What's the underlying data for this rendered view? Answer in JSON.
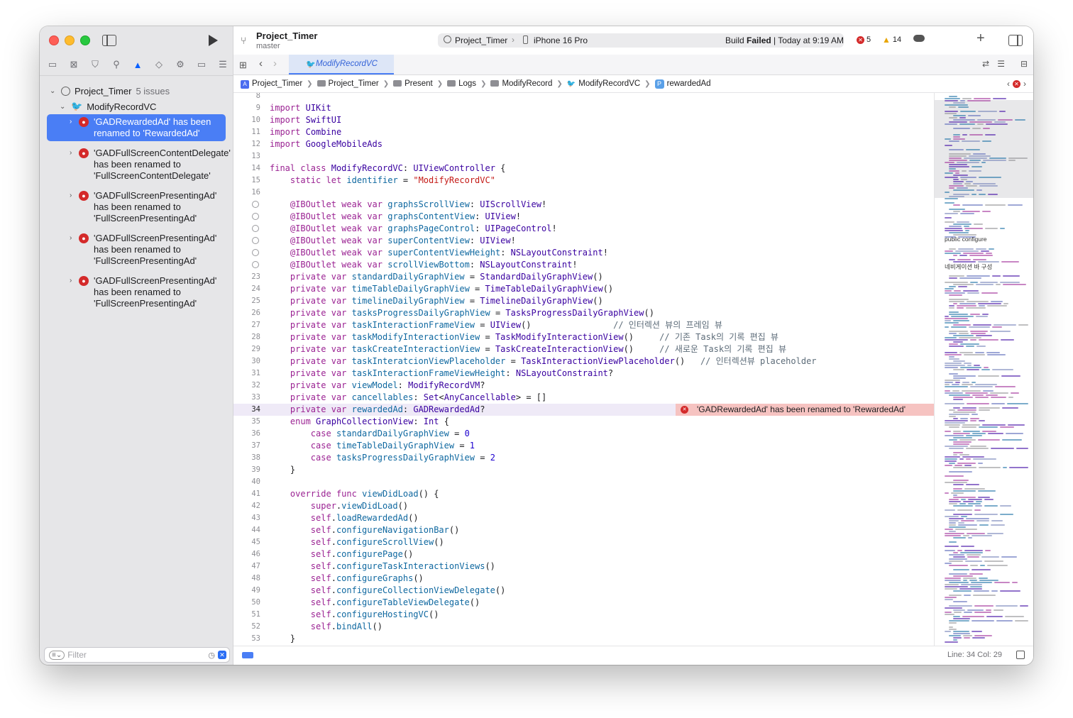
{
  "toolbar": {
    "project_title": "Project_Timer",
    "branch": "master",
    "scheme": "Project_Timer",
    "device": "iPhone 16 Pro",
    "build_status_prefix": "Build ",
    "build_status_bold": "Failed",
    "build_status_suffix": " | Today at 9:19 AM",
    "error_count": "5",
    "warning_count": "14"
  },
  "sidebar": {
    "project": "Project_Timer",
    "issue_count": "5 issues",
    "file": "ModifyRecordVC",
    "issues": [
      "'GADRewardedAd' has been renamed to 'RewardedAd'",
      "'GADFullScreenContentDelegate' has been renamed to 'FullScreenContentDelegate'",
      "'GADFullScreenPresentingAd' has been renamed to 'FullScreenPresentingAd'",
      "'GADFullScreenPresentingAd' has been renamed to 'FullScreenPresentingAd'",
      "'GADFullScreenPresentingAd' has been renamed to 'FullScreenPresentingAd'"
    ],
    "filter_placeholder": "Filter"
  },
  "tab": {
    "label": "ModifyRecordVC"
  },
  "breadcrumbs": [
    "Project_Timer",
    "Project_Timer",
    "Present",
    "Logs",
    "ModifyRecord",
    "ModifyRecordVC",
    "rewardedAd"
  ],
  "editor": {
    "inline_error": "'GADRewardedAd' has been renamed to 'RewardedAd'",
    "current_line": 34,
    "lines": [
      {
        "n": "8",
        "t": ""
      },
      {
        "n": "9",
        "t": "import UIKit"
      },
      {
        "n": "10",
        "t": "import SwiftUI"
      },
      {
        "n": "11",
        "t": "import Combine"
      },
      {
        "n": "12",
        "t": "import GoogleMobileAds"
      },
      {
        "n": "13",
        "t": ""
      },
      {
        "n": "14",
        "t": "final class ModifyRecordVC: UIViewController {"
      },
      {
        "n": "15",
        "t": "    static let identifier = \"ModifyRecordVC\""
      },
      {
        "n": "16",
        "t": ""
      },
      {
        "n": "",
        "t": "    @IBOutlet weak var graphsScrollView: UIScrollView!",
        "bp": true
      },
      {
        "n": "",
        "t": "    @IBOutlet weak var graphsContentView: UIView!",
        "bp": true
      },
      {
        "n": "",
        "t": "    @IBOutlet weak var graphsPageControl: UIPageControl!",
        "bp": true
      },
      {
        "n": "",
        "t": "    @IBOutlet weak var superContentView: UIView!",
        "bp": true
      },
      {
        "n": "",
        "t": "    @IBOutlet weak var superContentViewHeight: NSLayoutConstraint!",
        "bp": true
      },
      {
        "n": "",
        "t": "    @IBOutlet weak var scrollViewBottom: NSLayoutConstraint!",
        "bp": true
      },
      {
        "n": "23",
        "t": "    private var standardDailyGraphView = StandardDailyGraphView()"
      },
      {
        "n": "24",
        "t": "    private var timeTableDailyGraphView = TimeTableDailyGraphView()"
      },
      {
        "n": "25",
        "t": "    private var timelineDailyGraphView = TimelineDailyGraphView()"
      },
      {
        "n": "26",
        "t": "    private var tasksProgressDailyGraphView = TasksProgressDailyGraphView()"
      },
      {
        "n": "27",
        "t": "    private var taskInteractionFrameView = UIView()                // 인터렉션 뷰의 프레임 뷰"
      },
      {
        "n": "28",
        "t": "    private var taskModifyInteractionView = TaskModifyInteractionView()     // 기존 Task의 기록 편집 뷰"
      },
      {
        "n": "29",
        "t": "    private var taskCreateInteractionView = TaskCreateInteractionView()     // 새로운 Task의 기록 편집 뷰"
      },
      {
        "n": "30",
        "t": "    private var taskInteratcionViewPlaceholder = TaskInteractionViewPlaceholder()   // 인터렉션뷰 placeholder"
      },
      {
        "n": "31",
        "t": "    private var taskInteractionFrameViewHeight: NSLayoutConstraint?"
      },
      {
        "n": "32",
        "t": "    private var viewModel: ModifyRecordVM?"
      },
      {
        "n": "33",
        "t": "    private var cancellables: Set<AnyCancellable> = []"
      },
      {
        "n": "34",
        "t": "    private var rewardedAd: GADRewardedAd?"
      },
      {
        "n": "35",
        "t": "    enum GraphCollectionView: Int {"
      },
      {
        "n": "36",
        "t": "        case standardDailyGraphView = 0"
      },
      {
        "n": "37",
        "t": "        case timeTableDailyGraphView = 1"
      },
      {
        "n": "38",
        "t": "        case tasksProgressDailyGraphView = 2"
      },
      {
        "n": "39",
        "t": "    }"
      },
      {
        "n": "40",
        "t": ""
      },
      {
        "n": "41",
        "t": "    override func viewDidLoad() {"
      },
      {
        "n": "42",
        "t": "        super.viewDidLoad()"
      },
      {
        "n": "43",
        "t": "        self.loadRewardedAd()"
      },
      {
        "n": "44",
        "t": "        self.configureNavigationBar()"
      },
      {
        "n": "45",
        "t": "        self.configureScrollView()"
      },
      {
        "n": "46",
        "t": "        self.configurePage()"
      },
      {
        "n": "47",
        "t": "        self.configureTaskInteractionViews()"
      },
      {
        "n": "48",
        "t": "        self.configureGraphs()"
      },
      {
        "n": "49",
        "t": "        self.configureCollectionViewDelegate()"
      },
      {
        "n": "50",
        "t": "        self.configureTableViewDelegate()"
      },
      {
        "n": "51",
        "t": "        self.configureHostingVC()"
      },
      {
        "n": "52",
        "t": "        self.bindAll()"
      },
      {
        "n": "53",
        "t": "    }"
      }
    ]
  },
  "minimap": {
    "labels": [
      "public configure",
      "네비게이션 바 구성",
      "뷰 구성",
      "기기별 height...우와 아닌 경우)",
      "바인딩"
    ]
  },
  "status": {
    "position": "Line: 34  Col: 29"
  },
  "colors": {
    "accent": "#4a7ef5",
    "error": "#d42a2a",
    "error_bg": "#f6c3c1"
  }
}
